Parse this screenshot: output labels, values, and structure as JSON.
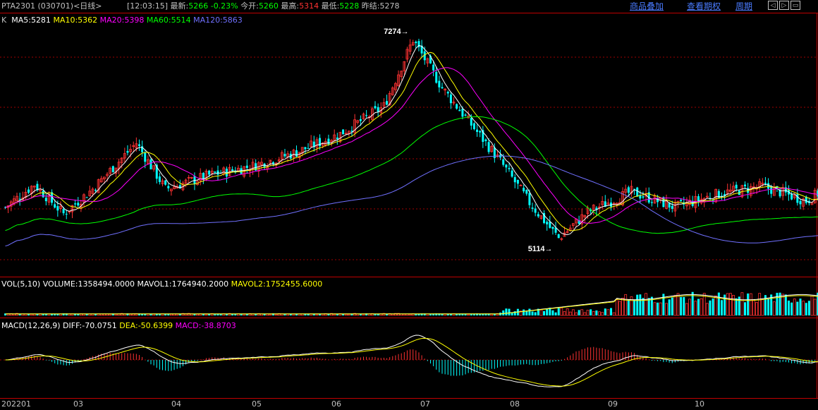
{
  "header": {
    "title": "PTA2301 (030701)<日线>",
    "time": "[12:03:15]",
    "latest_label": "最新:",
    "latest_value": "5266",
    "change": "-0.23%",
    "open_label": "今开:",
    "open_value": "5260",
    "high_label": "最高:",
    "high_value": "5314",
    "low_label": "最低:",
    "low_value": "5228",
    "prev_label": "昨结:",
    "prev_value": "5278",
    "links": [
      "商品叠加",
      "查看期权",
      "周期"
    ],
    "nav_icons": [
      "prev-icon",
      "next-icon",
      "window-icon"
    ]
  },
  "main_legend": {
    "k": "K",
    "ma5": "MA5:5281",
    "ma10": "MA10:5362",
    "ma20": "MA20:5398",
    "ma60": "MA60:5514",
    "ma120": "MA120:5863"
  },
  "annotations": {
    "high": "7274",
    "low": "5114"
  },
  "vol_legend": {
    "label": "VOL(5,10)",
    "volume": "VOLUME:1358494.0000",
    "mavol1": "MAVOL1:1764940.2000",
    "mavol2": "MAVOL2:1752455.6000"
  },
  "macd_legend": {
    "label": "MACD(12,26,9)",
    "diff": "DIFF:-70.0751",
    "dea": "DEA:-50.6399",
    "macd": "MACD:-38.8703"
  },
  "x_axis": [
    "202201",
    "03",
    "04",
    "05",
    "06",
    "07",
    "08",
    "09",
    "10"
  ],
  "colors": {
    "up": "#ff3232",
    "down": "#00ffff",
    "ma5": "#ffffff",
    "ma10": "#ffff00",
    "ma20": "#ff00ff",
    "ma60": "#00ff00",
    "ma120": "#7070ff",
    "grid": "#a00000",
    "link": "#4a7bff"
  },
  "chart_data": {
    "type": "candlestick",
    "price_range": [
      4850,
      7400
    ],
    "price_anchor_points": [
      [
        0,
        5450
      ],
      [
        10,
        5700
      ],
      [
        20,
        5380
      ],
      [
        30,
        5650
      ],
      [
        45,
        6150
      ],
      [
        55,
        5650
      ],
      [
        70,
        5800
      ],
      [
        85,
        5900
      ],
      [
        100,
        6050
      ],
      [
        115,
        6250
      ],
      [
        130,
        6550
      ],
      [
        140,
        7274
      ],
      [
        150,
        6750
      ],
      [
        160,
        6350
      ],
      [
        170,
        5950
      ],
      [
        180,
        5500
      ],
      [
        190,
        5114
      ],
      [
        200,
        5400
      ],
      [
        215,
        5620
      ],
      [
        230,
        5450
      ],
      [
        245,
        5600
      ],
      [
        260,
        5680
      ],
      [
        275,
        5520
      ],
      [
        285,
        5720
      ],
      [
        300,
        5330
      ],
      [
        315,
        5260
      ]
    ],
    "ma_final": {
      "MA5": 5281,
      "MA10": 5362,
      "MA20": 5398,
      "MA60": 5514,
      "MA120": 5863
    },
    "volume_final": 1358494,
    "mavol_final": [
      1764940.2,
      1752455.6
    ],
    "macd_final": {
      "DIFF": -70.0751,
      "DEA": -50.6399,
      "MACD": -38.8703
    }
  }
}
